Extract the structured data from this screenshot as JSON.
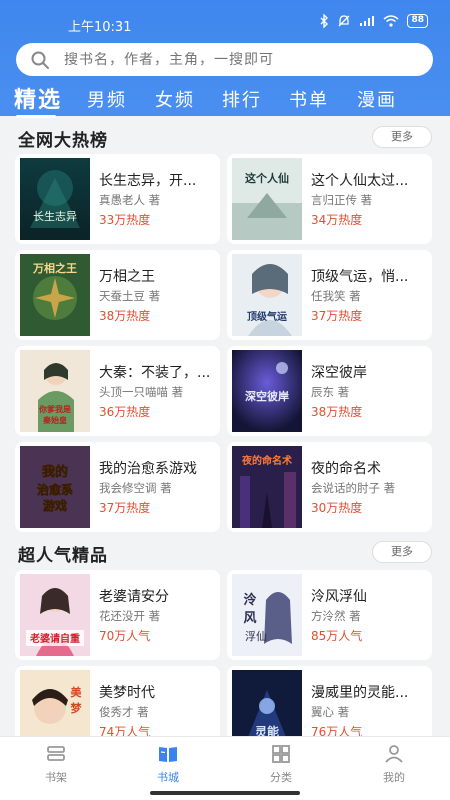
{
  "status": {
    "time": "上午10:31",
    "battery": "88"
  },
  "search": {
    "placeholder": "搜书名，作者，主角，一搜即可"
  },
  "tabs": [
    {
      "label": "精选",
      "active": true
    },
    {
      "label": "男频"
    },
    {
      "label": "女频"
    },
    {
      "label": "排行"
    },
    {
      "label": "书单"
    },
    {
      "label": "漫画"
    }
  ],
  "sections": [
    {
      "title": "全网大热榜",
      "more": "更多",
      "books": [
        {
          "title": "长生志异，开...",
          "author": "真愚老人 著",
          "heat": "33万热度",
          "cover_text": "长生志异"
        },
        {
          "title": "这个人仙太过...",
          "author": "言归正传 著",
          "heat": "34万热度",
          "cover_text": "这个人仙"
        },
        {
          "title": "万相之王",
          "author": "天蚕土豆 著",
          "heat": "38万热度",
          "cover_text": "万相之王"
        },
        {
          "title": "顶级气运，悄...",
          "author": "任我笑 著",
          "heat": "37万热度",
          "cover_text": "顶级气运"
        },
        {
          "title": "大秦：不装了，...",
          "author": "头顶一只喵喵 著",
          "heat": "36万热度",
          "cover_text": "你爹我是秦始皇"
        },
        {
          "title": "深空彼岸",
          "author": "辰东 著",
          "heat": "38万热度",
          "cover_text": "深空彼岸"
        },
        {
          "title": "我的治愈系游戏",
          "author": "我会修空调 著",
          "heat": "37万热度",
          "cover_text": "我的治愈系游戏"
        },
        {
          "title": "夜的命名术",
          "author": "会说话的肘子 著",
          "heat": "30万热度",
          "cover_text": "夜的命名术"
        }
      ]
    },
    {
      "title": "超人气精品",
      "more": "更多",
      "books": [
        {
          "title": "老婆请安分",
          "author": "花还没开 著",
          "heat": "70万人气",
          "cover_text": "老婆请自重"
        },
        {
          "title": "泠风浮仙",
          "author": "方泠然 著",
          "heat": "85万人气",
          "cover_text": "泠风浮仙"
        },
        {
          "title": "美梦时代",
          "author": "俊秀才 著",
          "heat": "74万人气",
          "cover_text": "美梦"
        },
        {
          "title": "漫威里的灵能...",
          "author": "翼心 著",
          "heat": "76万人气",
          "cover_text": "灵能"
        }
      ]
    }
  ],
  "bottom_nav": [
    {
      "label": "书架",
      "icon": "bookshelf-icon"
    },
    {
      "label": "书城",
      "icon": "bookstore-icon",
      "active": true
    },
    {
      "label": "分类",
      "icon": "grid-icon"
    },
    {
      "label": "我的",
      "icon": "profile-icon"
    }
  ],
  "colors": {
    "brand": "#3f87ee",
    "heat": "#e0502e"
  }
}
